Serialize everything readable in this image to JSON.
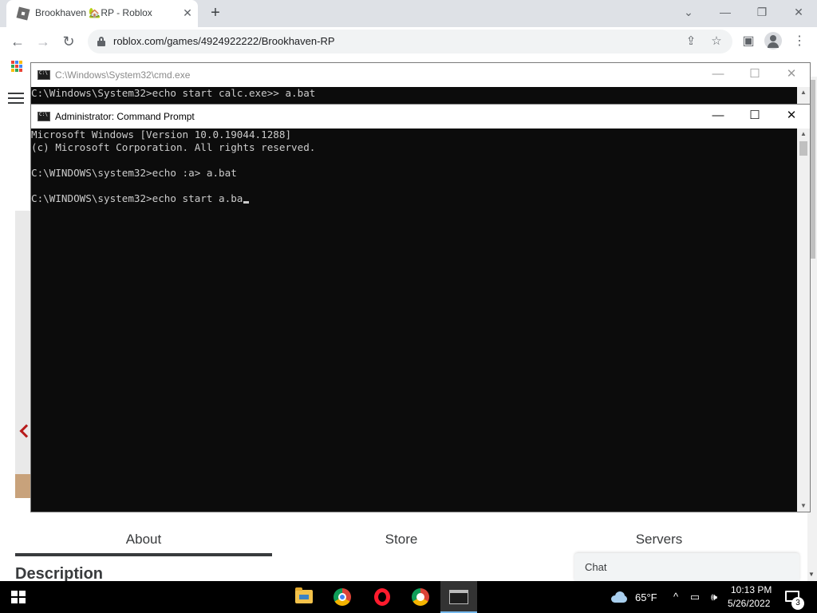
{
  "browser": {
    "tab_title": "Brookhaven 🏡RP - Roblox",
    "tab_close": "✕",
    "new_tab": "+",
    "url": "roblox.com/games/4924922222/Brookhaven-RP",
    "window_controls": {
      "tabsearch": "⌄",
      "minimize": "—",
      "restore": "❐",
      "close": "✕"
    },
    "toolbar": {
      "back": "←",
      "forward": "→",
      "reload": "↻",
      "share": "⇪",
      "bookmark": "☆",
      "sidepanel": "▣",
      "menu": "⋮"
    }
  },
  "page": {
    "tabs": [
      "About",
      "Store",
      "Servers"
    ],
    "active_tab": "About",
    "section_heading": "Description",
    "chat_label": "Chat"
  },
  "cmd_back": {
    "title": "C:\\Windows\\System32\\cmd.exe",
    "line": "C:\\Windows\\System32>echo start calc.exe>> a.bat",
    "controls": {
      "minimize": "—",
      "maximize": "☐",
      "close": "✕"
    }
  },
  "cmd_front": {
    "title": "Administrator: Command Prompt",
    "lines": [
      "Microsoft Windows [Version 10.0.19044.1288]",
      "(c) Microsoft Corporation. All rights reserved.",
      "",
      "C:\\WINDOWS\\system32>echo :a> a.bat",
      "",
      "C:\\WINDOWS\\system32>echo start a.ba"
    ],
    "controls": {
      "minimize": "—",
      "maximize": "☐",
      "close": "✕"
    }
  },
  "taskbar": {
    "apps": [
      "file-explorer-icon",
      "chrome-icon",
      "opera-icon",
      "chrome-alt-icon",
      "command-prompt-icon"
    ],
    "weather": "65°F",
    "time": "10:13 PM",
    "date": "5/26/2022",
    "notification_count": "3",
    "tray_chevron": "^",
    "tray_volume": "🕪"
  },
  "colors": {
    "console_bg": "#0c0c0c",
    "console_text": "#cccccc",
    "taskbar_bg": "#000000",
    "chrome_tabstrip": "#dee1e6"
  }
}
